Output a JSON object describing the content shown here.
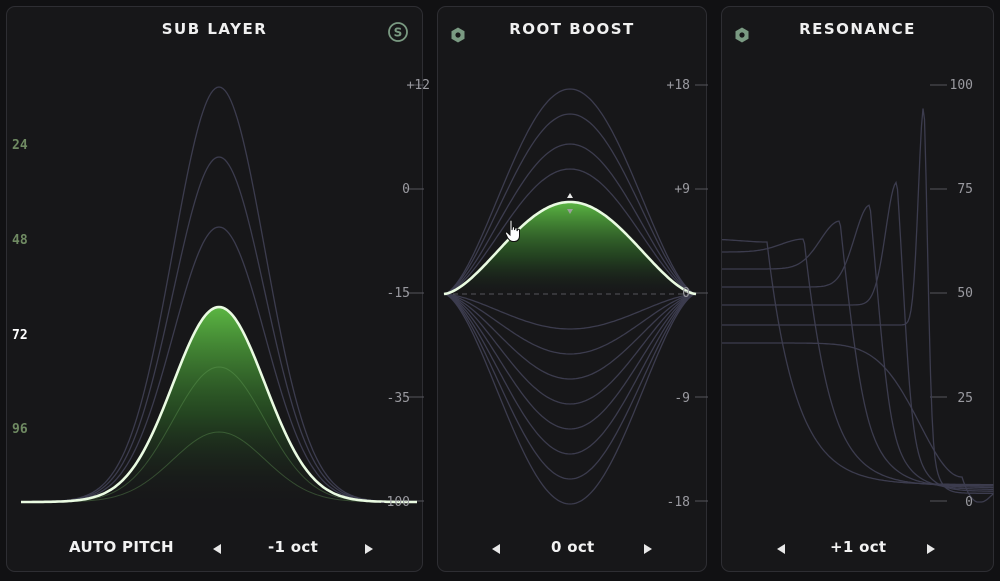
{
  "panels": {
    "sub_layer": {
      "title": "SUB LAYER",
      "solo_label": "S",
      "scale": [
        "+12",
        "0",
        "-15",
        "-35",
        "-100"
      ],
      "notes": [
        "24",
        "48",
        "72",
        "96"
      ],
      "active_note": "72",
      "mode_label": "AUTO PITCH",
      "value": "-1 oct"
    },
    "root_boost": {
      "title": "ROOT BOOST",
      "scale": [
        "+18",
        "+9",
        "0",
        "-9",
        "-18"
      ],
      "value": "0 oct"
    },
    "resonance": {
      "title": "RESONANCE",
      "scale": [
        "100",
        "75",
        "50",
        "25",
        "0"
      ],
      "value": "+1 oct"
    }
  },
  "colors": {
    "accent_green": "#5fbf45",
    "highlight_curve": "#eafbe2",
    "inactive_curve": "#3c3c4e",
    "logo_red": "#e0302c",
    "icon_green": "#7a9a82"
  },
  "icons": {
    "logo": "red-arrow-logo",
    "solo": "solo-icon",
    "settings": "hexagon-icon"
  }
}
